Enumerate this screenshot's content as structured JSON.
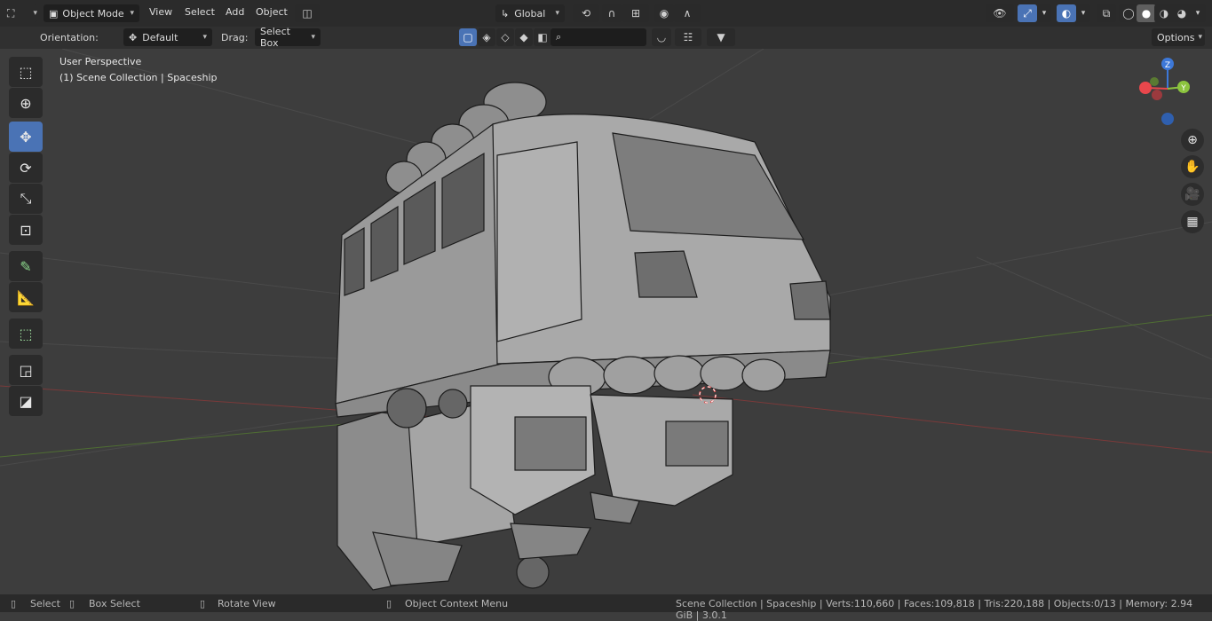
{
  "header": {
    "mode": "Object Mode",
    "menus": [
      "View",
      "Select",
      "Add",
      "Object"
    ],
    "transform_orientation": "Global",
    "options_label": "Options"
  },
  "tool_settings": {
    "orientation_label": "Orientation:",
    "orientation_value": "Default",
    "drag_label": "Drag:",
    "drag_value": "Select Box"
  },
  "viewport": {
    "view_name": "User Perspective",
    "collection_info": "(1) Scene Collection | Spaceship",
    "gizmo_axes": [
      "Z",
      "Y",
      "X"
    ]
  },
  "toolbar": {
    "tools": [
      {
        "name": "select-box-tool",
        "icon": "select-box-icon"
      },
      {
        "name": "cursor-tool",
        "icon": "cursor-icon"
      },
      {
        "name": "move-tool",
        "icon": "move-icon",
        "active": true
      },
      {
        "name": "rotate-tool",
        "icon": "rotate-icon"
      },
      {
        "name": "scale-tool",
        "icon": "scale-icon"
      },
      {
        "name": "transform-tool",
        "icon": "transform-icon"
      },
      {
        "name": "annotate-tool",
        "icon": "annotate-icon"
      },
      {
        "name": "measure-tool",
        "icon": "measure-icon"
      },
      {
        "name": "add-cube-tool",
        "icon": "add-cube-icon"
      }
    ]
  },
  "status_bar": {
    "select": "Select",
    "box_select": "Box Select",
    "rotate_view": "Rotate View",
    "context_menu": "Object Context Menu",
    "stats": "Scene Collection | Spaceship | Verts:110,660 | Faces:109,818 | Tris:220,188 | Objects:0/13 | Memory: 2.94 GiB | 3.0.1"
  },
  "colors": {
    "accent": "#4a73b5",
    "axis_x": "#e8474c",
    "axis_y": "#8cc43e",
    "axis_z": "#3d78d8"
  }
}
